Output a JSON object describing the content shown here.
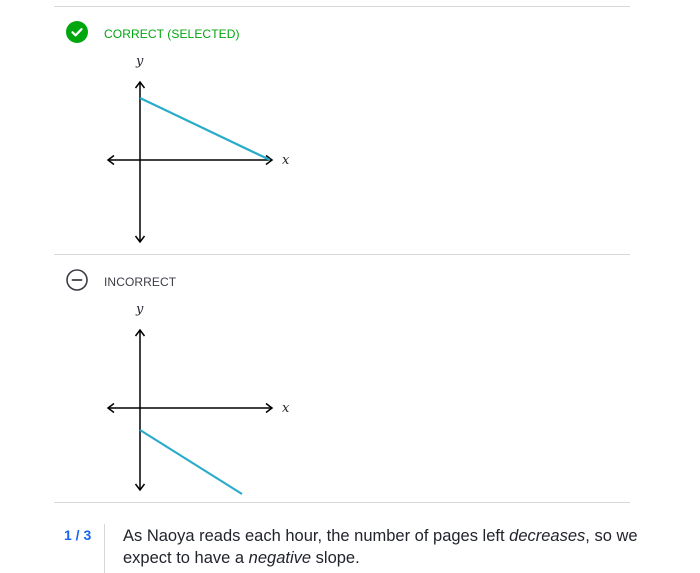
{
  "choices": [
    {
      "status": "correct",
      "label": "CORRECT (SELECTED)",
      "graph": {
        "xlabel": "x",
        "ylabel": "y",
        "line": "decreasing, positive y-intercept, ends on positive x-axis"
      }
    },
    {
      "status": "incorrect",
      "label": "INCORRECT",
      "graph": {
        "xlabel": "x",
        "ylabel": "y",
        "line": "decreasing, negative y-intercept"
      }
    }
  ],
  "hint": {
    "counter": "1 / 3",
    "text_part1": "As Naoya reads each hour, the number of pages left ",
    "emph1": "decreases",
    "text_part2": ", so we expect to have a ",
    "emph2": "negative",
    "text_part3": " slope."
  },
  "colors": {
    "correct": "#00a60e",
    "graph_line": "#29abca",
    "hint_counter": "#1865f2",
    "divider": "#d6d8da"
  }
}
